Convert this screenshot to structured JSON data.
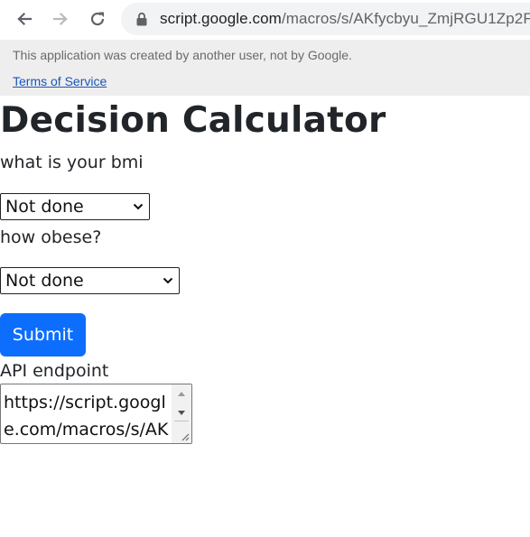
{
  "browser": {
    "url_host": "script.google.com",
    "url_path": "/macros/s/AKfycbyu_ZmjRGU1Zp2F",
    "back_icon": "arrow-back-icon",
    "forward_icon": "arrow-forward-icon",
    "reload_icon": "reload-icon",
    "lock_icon": "lock-icon"
  },
  "banner": {
    "warning": "This application was created by another user, not by Google.",
    "terms_link": "Terms of Service"
  },
  "page": {
    "title": "Decision Calculator",
    "bmi_label": "what is your bmi",
    "bmi_select_value": "Not done",
    "obese_label": "how obese?",
    "obese_select_value": "Not done",
    "submit_label": "Submit",
    "api_label": "API endpoint",
    "api_value": "https://script.google.com/macros/s/AKfy"
  },
  "colors": {
    "primary_button": "#0d6efd",
    "banner_bg": "#eeeeee",
    "link": "#1a56b8"
  }
}
